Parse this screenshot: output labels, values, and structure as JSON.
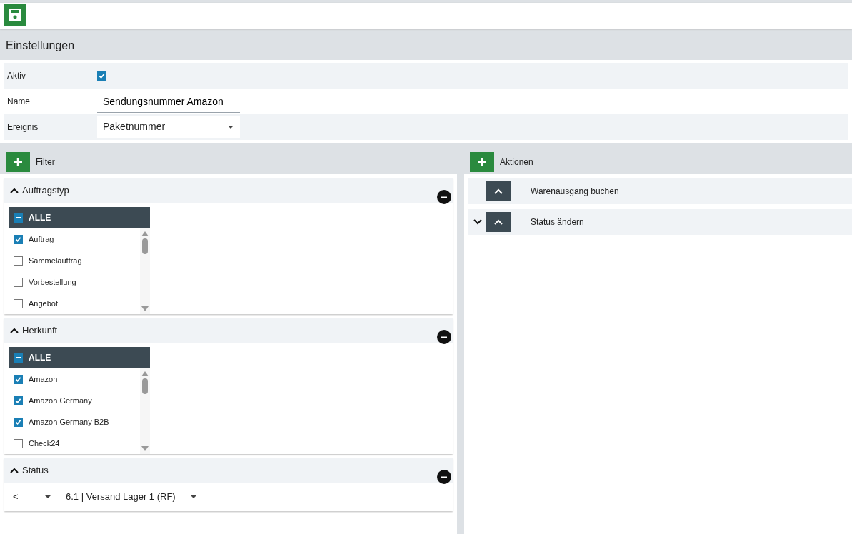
{
  "settings": {
    "title": "Einstellungen",
    "fields": [
      {
        "kind": "checkbox",
        "label": "Aktiv",
        "checked": true
      },
      {
        "kind": "text",
        "label": "Name",
        "value": "Sendungsnummer Amazon"
      },
      {
        "kind": "select",
        "label": "Ereignis",
        "value": "Paketnummer"
      }
    ]
  },
  "filter": {
    "title": "Filter",
    "groups": [
      {
        "kind": "list",
        "title": "Auftragstyp",
        "expanded": true,
        "all_label": "ALLE",
        "all_indeterminate": true,
        "items": [
          {
            "label": "Auftrag",
            "checked": true
          },
          {
            "label": "Sammelauftrag",
            "checked": false
          },
          {
            "label": "Vorbestellung",
            "checked": false
          },
          {
            "label": "Angebot",
            "checked": false
          }
        ]
      },
      {
        "kind": "list",
        "title": "Herkunft",
        "expanded": true,
        "all_label": "ALLE",
        "all_indeterminate": true,
        "items": [
          {
            "label": "Amazon",
            "checked": true
          },
          {
            "label": "Amazon Germany",
            "checked": true
          },
          {
            "label": "Amazon Germany B2B",
            "checked": true
          },
          {
            "label": "Check24",
            "checked": false
          }
        ]
      },
      {
        "kind": "status",
        "title": "Status",
        "expanded": true,
        "operator": "<",
        "value": "6.1 | Versand Lager 1 (RF)"
      }
    ]
  },
  "actions": {
    "title": "Aktionen",
    "items": [
      {
        "label": "Warenausgang buchen",
        "toggle": false
      },
      {
        "label": "Status ändern",
        "toggle": true
      }
    ]
  }
}
